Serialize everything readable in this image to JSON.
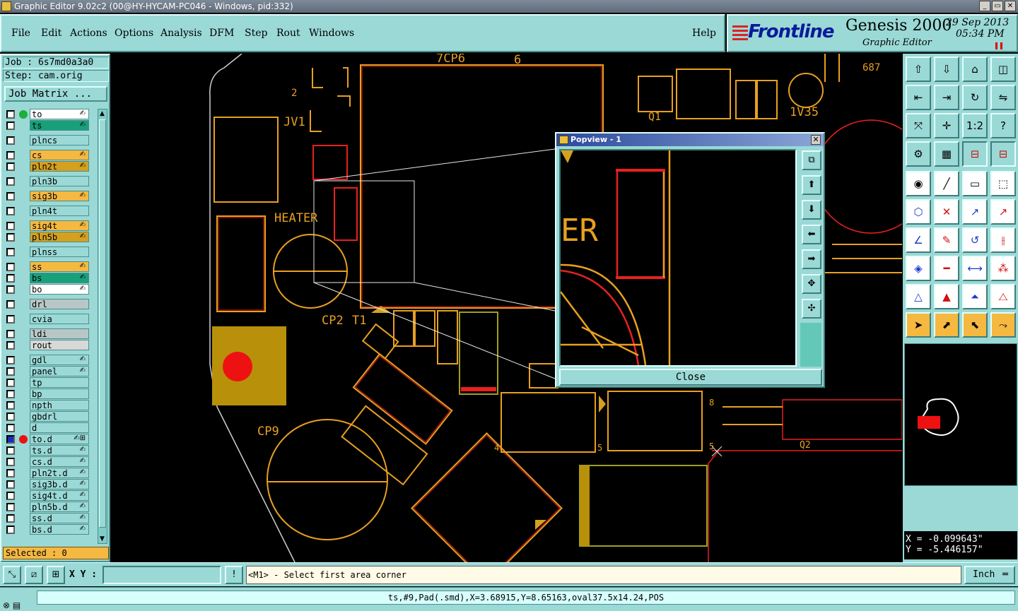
{
  "window": {
    "title": "Graphic Editor 9.02c2 (00@HY-HYCAM-PC046 - Windows, pid:332)"
  },
  "menu": {
    "items": [
      {
        "label": "File"
      },
      {
        "label": "Edit"
      },
      {
        "label": "Actions"
      },
      {
        "label": "Options"
      },
      {
        "label": "Analysis"
      },
      {
        "label": "DFM"
      },
      {
        "label": "Step"
      },
      {
        "label": "Rout"
      },
      {
        "label": "Windows"
      }
    ],
    "help": "Help"
  },
  "brand": {
    "logo": "Frontline",
    "product": "Genesis 2000",
    "subtitle": "Graphic Editor",
    "date": "29 Sep 2013",
    "time": "05:34 PM"
  },
  "job": {
    "job_line": "Job : 6s7md0a3a0",
    "step_line": "Step: cam.orig",
    "matrix_button": "Job Matrix ..."
  },
  "layers": [
    {
      "name": "to",
      "color": "#ffffff",
      "dot": "#1fae3a",
      "icon": "✍"
    },
    {
      "name": "ts",
      "color": "#18a07a",
      "dot": "",
      "icon": "✍"
    },
    {
      "name": "plncs",
      "color": "#9ad9d6",
      "dot": "",
      "icon": ""
    },
    {
      "name": "cs",
      "color": "#f5b841",
      "dot": "",
      "icon": "✍"
    },
    {
      "name": "pln2t",
      "color": "#d4a020",
      "dot": "",
      "icon": "✍"
    },
    {
      "name": "pln3b",
      "color": "#9ad9d6",
      "dot": "",
      "icon": ""
    },
    {
      "name": "sig3b",
      "color": "#f5b841",
      "dot": "",
      "icon": "✍"
    },
    {
      "name": "pln4t",
      "color": "#9ad9d6",
      "dot": "",
      "icon": ""
    },
    {
      "name": "sig4t",
      "color": "#f5b841",
      "dot": "",
      "icon": "✍"
    },
    {
      "name": "pln5b",
      "color": "#d4a020",
      "dot": "",
      "icon": "✍"
    },
    {
      "name": "plnss",
      "color": "#9ad9d6",
      "dot": "",
      "icon": ""
    },
    {
      "name": "ss",
      "color": "#f5b841",
      "dot": "",
      "icon": "✍"
    },
    {
      "name": "bs",
      "color": "#18a07a",
      "dot": "",
      "icon": "✍"
    },
    {
      "name": "bo",
      "color": "#ffffff",
      "dot": "",
      "icon": "✍"
    },
    {
      "name": "drl",
      "color": "#b9c6c6",
      "dot": "",
      "icon": ""
    },
    {
      "name": "cvia",
      "color": "#9ad9d6",
      "dot": "",
      "icon": ""
    },
    {
      "name": "ldi",
      "color": "#b9c6c6",
      "dot": "",
      "icon": ""
    },
    {
      "name": "rout",
      "color": "#d8d8d8",
      "dot": "",
      "icon": ""
    },
    {
      "name": "gdl",
      "color": "#9ad9d6",
      "dot": "",
      "icon": "✍"
    },
    {
      "name": "panel",
      "color": "#9ad9d6",
      "dot": "",
      "icon": "✍"
    },
    {
      "name": "tp",
      "color": "#9ad9d6",
      "dot": "",
      "icon": ""
    },
    {
      "name": "bp",
      "color": "#9ad9d6",
      "dot": "",
      "icon": ""
    },
    {
      "name": "npth",
      "color": "#9ad9d6",
      "dot": "",
      "icon": ""
    },
    {
      "name": "gbdrl",
      "color": "#9ad9d6",
      "dot": "",
      "icon": ""
    },
    {
      "name": "d",
      "color": "#9ad9d6",
      "dot": "",
      "icon": ""
    },
    {
      "name": "to.d",
      "color": "#9ad9d6",
      "dot": "#ee1111",
      "icon": "✍⊞"
    },
    {
      "name": "ts.d",
      "color": "#9ad9d6",
      "dot": "",
      "icon": "✍"
    },
    {
      "name": "cs.d",
      "color": "#9ad9d6",
      "dot": "",
      "icon": "✍"
    },
    {
      "name": "pln2t.d",
      "color": "#9ad9d6",
      "dot": "",
      "icon": "✍"
    },
    {
      "name": "sig3b.d",
      "color": "#9ad9d6",
      "dot": "",
      "icon": "✍"
    },
    {
      "name": "sig4t.d",
      "color": "#9ad9d6",
      "dot": "",
      "icon": "✍"
    },
    {
      "name": "pln5b.d",
      "color": "#9ad9d6",
      "dot": "",
      "icon": "✍"
    },
    {
      "name": "ss.d",
      "color": "#9ad9d6",
      "dot": "",
      "icon": "✍"
    },
    {
      "name": "bs.d",
      "color": "#9ad9d6",
      "dot": "",
      "icon": "✍"
    }
  ],
  "selected_text": "Selected : 0",
  "canvas_labels": {
    "heater": "HEATER",
    "jv1": "JV1",
    "cp2": "CP2",
    "t1": "T1",
    "cp9": "CP9",
    "cp6": "7CP6",
    "six": "6",
    "d1": "2",
    "v35": "1V35",
    "num687": "687",
    "q1": "Q1",
    "q2": "Q2",
    "e5": "5",
    "e8": "8",
    "e4": "4",
    "e5b": "5"
  },
  "popview": {
    "title": "Popview - 1",
    "close_label": "Close",
    "view_text": "ER"
  },
  "coords": {
    "x_line": "X = -0.099643\"",
    "y_line": "Y = -5.446157\""
  },
  "bottom": {
    "xy_label": "X Y :",
    "xy_value": "",
    "prompt": "<M1> - Select first area corner",
    "unit": "Inch"
  },
  "status": {
    "text": "ts,#9,Pad(.smd),X=3.68915,Y=8.65163,oval37.5x14.24,POS"
  }
}
